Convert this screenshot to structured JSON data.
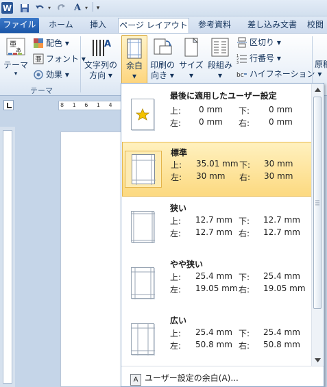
{
  "window": {
    "app_icon": "W"
  },
  "quick_access": {
    "icons": [
      "save-icon",
      "undo-icon",
      "redo-icon",
      "format-icon",
      "customize-icon"
    ]
  },
  "tabs": {
    "file": "ファイル",
    "home": "ホーム",
    "insert": "挿入",
    "page_layout": "ページ レイアウト",
    "references": "参考資料",
    "mailings": "差し込み文書",
    "review_partial": "校閲"
  },
  "ribbon": {
    "theme": {
      "label": "テーマ",
      "group": "テーマ",
      "colors": "配色 ▾",
      "fonts": "フォント ▾",
      "effects": "効果 ▾"
    },
    "text_direction": {
      "line1": "文字列の",
      "line2": "方向 ▾"
    },
    "margins": {
      "line1": "余白",
      "line2": "▾"
    },
    "orientation": {
      "line1": "印刷の",
      "line2": "向き ▾"
    },
    "size": {
      "line1": "サイズ",
      "line2": "▾"
    },
    "columns": {
      "line1": "段組み",
      "line2": "▾"
    },
    "breaks": "区切り ▾",
    "line_numbers": "行番号 ▾",
    "hyphenation": "ハイフネーション ▾",
    "manuscript_partial": "原稿"
  },
  "ruler": {
    "top_text": "8 1 6 1 4"
  },
  "margins_menu": {
    "items": [
      {
        "title": "最後に適用したユーザー設定",
        "top_label": "上:",
        "top": "0 mm",
        "bottom_label": "下:",
        "bottom": "0 mm",
        "left_label": "左:",
        "left": "0 mm",
        "right_label": "右:",
        "right": "0 mm"
      },
      {
        "title": "標準",
        "top_label": "上:",
        "top": "35.01 mm",
        "bottom_label": "下:",
        "bottom": "30 mm",
        "left_label": "左:",
        "left": "30 mm",
        "right_label": "右:",
        "right": "30 mm"
      },
      {
        "title": "狭い",
        "top_label": "上:",
        "top": "12.7 mm",
        "bottom_label": "下:",
        "bottom": "12.7 mm",
        "left_label": "左:",
        "left": "12.7 mm",
        "right_label": "右:",
        "right": "12.7 mm"
      },
      {
        "title": "やや狭い",
        "top_label": "上:",
        "top": "25.4 mm",
        "bottom_label": "下:",
        "bottom": "25.4 mm",
        "left_label": "左:",
        "left": "19.05 mm",
        "right_label": "右:",
        "right": "19.05 mm"
      },
      {
        "title": "広い",
        "top_label": "上:",
        "top": "25.4 mm",
        "bottom_label": "下:",
        "bottom": "25.4 mm",
        "left_label": "左:",
        "left": "50.8 mm",
        "right_label": "右:",
        "right": "50.8 mm"
      }
    ],
    "selected_index": 1,
    "custom_label": "ユーザー設定の余白(A)...",
    "shortcut_key": "A"
  },
  "colors": {
    "accent_blue": "#1c57a8",
    "highlight": "#fcd980",
    "star": "#f3c200"
  }
}
